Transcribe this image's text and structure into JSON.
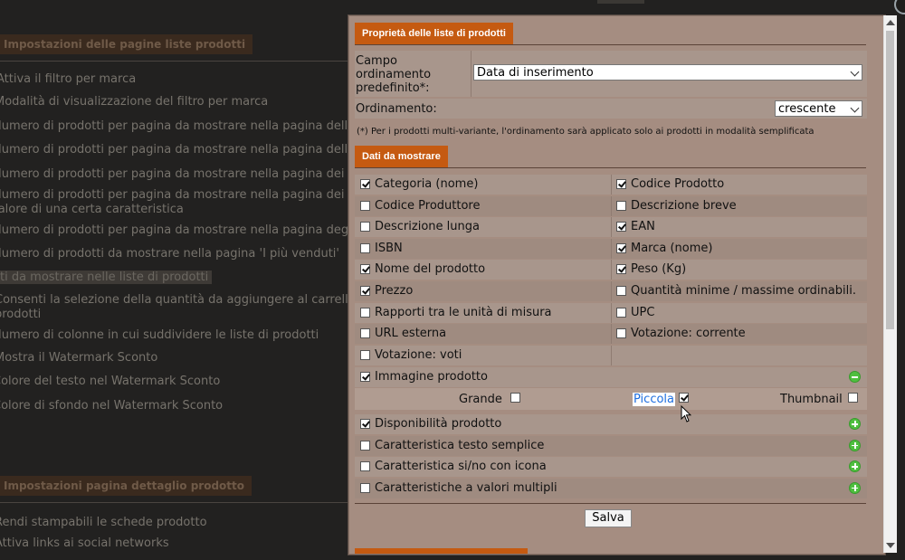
{
  "background": {
    "section1_title": "Impostazioni delle pagine liste prodotti",
    "rows": [
      "Attiva il filtro per marca",
      "Modalità di visualizzazione del filtro per marca",
      "Numero di prodotti per pagina da mostrare nella pagina delle categorie",
      "Numero di prodotti per pagina da mostrare nella pagina della lista",
      "Numero di prodotti per pagina da mostrare nella pagina dei risultati",
      "Numero di prodotti per pagina da mostrare nella pagina dei prodotti",
      "valore di una certa caratteristica",
      "Numero di prodotti per pagina da mostrare nella pagina degli ultimi",
      "Numero di prodotti da mostrare nella pagina 'I più venduti'",
      "Dati da mostrare nelle liste di prodotti",
      "Consenti la selezione della quantità da aggiungere al carrello dir",
      "prodotti",
      "Numero di colonne in cui suddividere le liste di prodotti",
      "Mostra il Watermark Sconto",
      "Colore del testo nel Watermark Sconto",
      "Colore di sfondo nel Watermark Sconto"
    ],
    "section2_title": "Impostazioni pagina dettaglio prodotto",
    "rows2": [
      "Rendi stampabili le schede prodotto",
      "Attiva links ai social networks"
    ]
  },
  "modal": {
    "section_props_title": "Proprietà delle liste di prodotti",
    "sort_field_label": "Campo ordinamento predefinito*:",
    "sort_field_value": "Data di inserimento",
    "sort_order_label": "Ordinamento:",
    "sort_order_value": "crescente",
    "note": "(*) Per i prodotti multi-variante, l'ordinamento sarà applicato solo ai prodotti in modalità semplificata",
    "section_data_title": "Dati da mostrare",
    "left_items": [
      {
        "label": "Categoria (nome)",
        "checked": true
      },
      {
        "label": "Codice Produttore",
        "checked": false
      },
      {
        "label": "Descrizione lunga",
        "checked": false
      },
      {
        "label": "ISBN",
        "checked": false
      },
      {
        "label": "Nome del prodotto",
        "checked": true
      },
      {
        "label": "Prezzo",
        "checked": true
      },
      {
        "label": "Rapporti tra le unità di misura",
        "checked": false
      },
      {
        "label": "URL esterna",
        "checked": false
      },
      {
        "label": "Votazione: voti",
        "checked": false
      }
    ],
    "right_items": [
      {
        "label": "Codice Prodotto",
        "checked": true
      },
      {
        "label": "Descrizione breve",
        "checked": false
      },
      {
        "label": "EAN",
        "checked": true
      },
      {
        "label": "Marca (nome)",
        "checked": true
      },
      {
        "label": "Peso (Kg)",
        "checked": true
      },
      {
        "label": "Quantità minime / massime ordinabili.",
        "checked": false
      },
      {
        "label": "UPC",
        "checked": false
      },
      {
        "label": "Votazione: corrente",
        "checked": false
      }
    ],
    "image_item": {
      "label": "Immagine prodotto",
      "checked": true
    },
    "image_sizes": [
      {
        "label": "Grande",
        "checked": false
      },
      {
        "label": "Piccola",
        "checked": true
      },
      {
        "label": "Thumbnail",
        "checked": false
      }
    ],
    "extra_items": [
      {
        "label": "Disponibilità prodotto",
        "checked": true
      },
      {
        "label": "Caratteristica testo semplice",
        "checked": false
      },
      {
        "label": "Caratteristica si/no con icona",
        "checked": false
      },
      {
        "label": "Caratteristiche a valori multipli",
        "checked": false
      }
    ],
    "save_label": "Salva"
  },
  "colors": {
    "accent": "#c55a11",
    "modal_bg": "#a58d81",
    "add_button": "#4fbf3f"
  }
}
